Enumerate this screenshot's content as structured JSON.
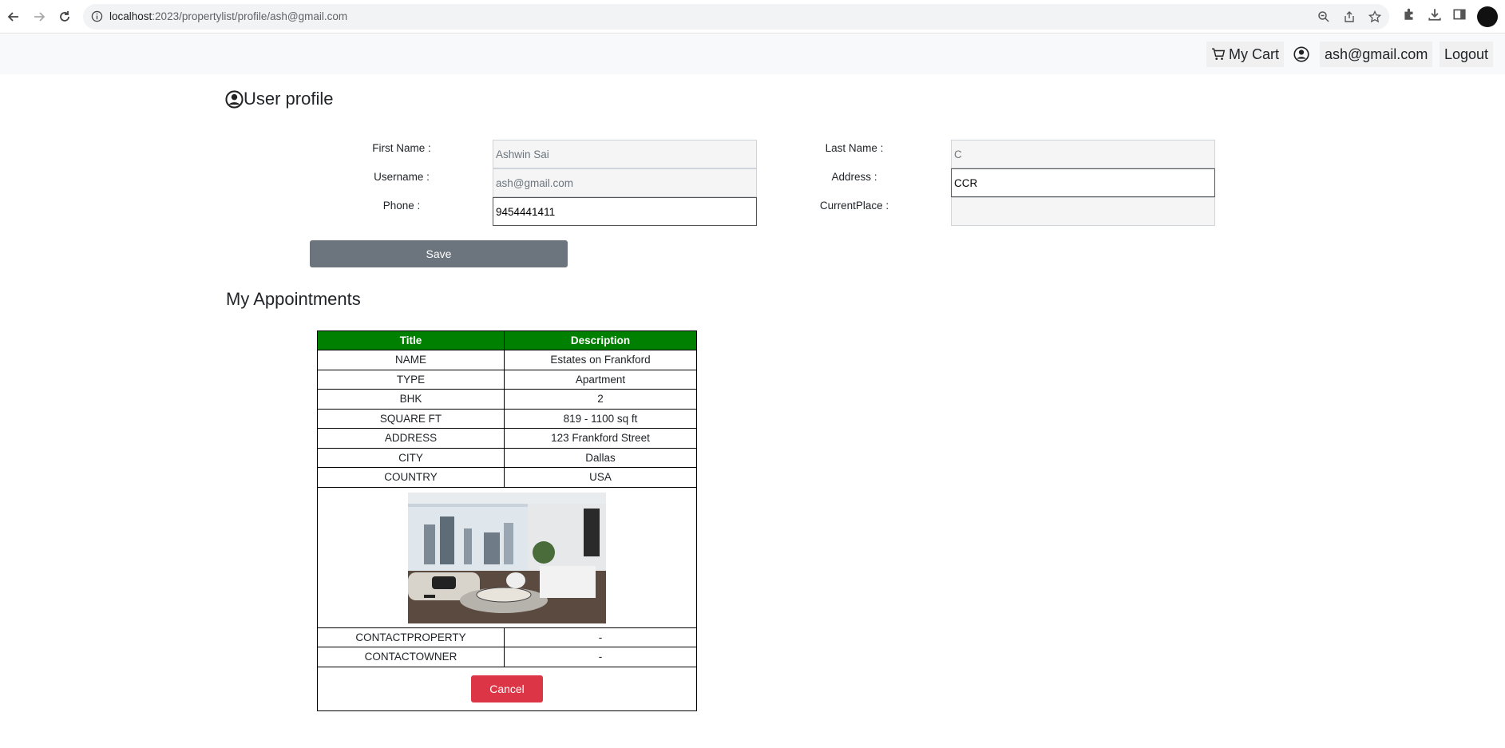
{
  "browser": {
    "url_host": "localhost",
    "url_rest": ":2023/propertylist/profile/ash@gmail.com"
  },
  "nav": {
    "cart_label": "My Cart",
    "user_email": "ash@gmail.com",
    "logout_label": "Logout"
  },
  "profile": {
    "title": "User profile",
    "fields": {
      "first_name_label": "First Name :",
      "first_name_value": "Ashwin Sai",
      "last_name_label": "Last Name :",
      "last_name_value": "C",
      "username_label": "Username :",
      "username_value": "ash@gmail.com",
      "address_label": "Address :",
      "address_value": "CCR",
      "phone_label": "Phone :",
      "phone_value": "9454441411",
      "current_place_label": "CurrentPlace :",
      "current_place_value": ""
    },
    "save_label": "Save"
  },
  "appointments": {
    "title": "My Appointments",
    "headers": [
      "Title",
      "Description"
    ],
    "rows": [
      [
        "NAME",
        "Estates on Frankford"
      ],
      [
        "TYPE",
        "Apartment"
      ],
      [
        "BHK",
        "2"
      ],
      [
        "SQUARE FT",
        "819 - 1100 sq ft"
      ],
      [
        "ADDRESS",
        "123 Frankford Street"
      ],
      [
        "CITY",
        "Dallas"
      ],
      [
        "COUNTRY",
        "USA"
      ]
    ],
    "contact_rows": [
      [
        "CONTACTPROPERTY",
        "-"
      ],
      [
        "CONTACTOWNER",
        "-"
      ]
    ],
    "cancel_label": "Cancel"
  }
}
